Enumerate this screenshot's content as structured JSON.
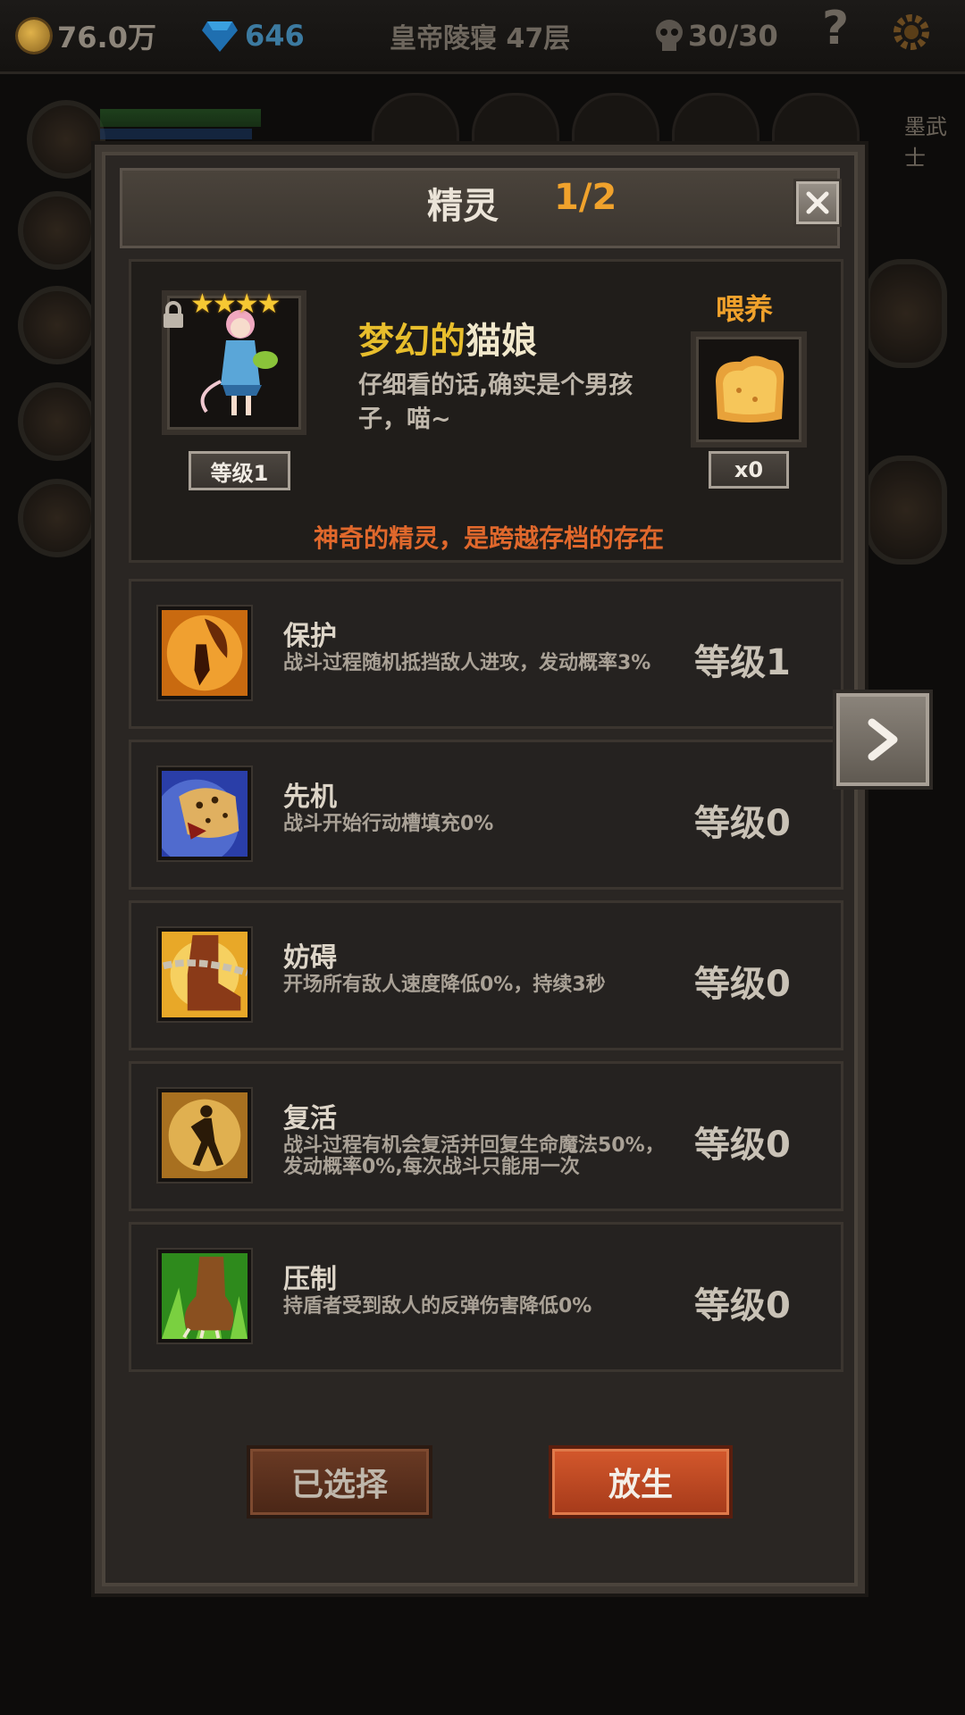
{
  "topbar": {
    "gold": "76.0万",
    "gems": "646",
    "location": "皇帝陵寝 47层",
    "stamina": "30/30",
    "help": "?"
  },
  "background": {
    "right_label": "墨武士"
  },
  "dialog": {
    "title": "精灵",
    "page": "1/2",
    "pet": {
      "stars": "★★★★",
      "level": "等级1",
      "name_prefix": "梦幻的",
      "name_main": "猫娘",
      "description": "仔细看的话,确实是个男孩子，喵~",
      "feed_label": "喂养",
      "food_count": "x0",
      "tagline": "神奇的精灵，是跨越存档的存在"
    },
    "skills": [
      {
        "name": "保护",
        "desc": "战斗过程随机抵挡敌人进攻，发动概率3%",
        "level": "等级1",
        "icon": "fairy-shield-icon"
      },
      {
        "name": "先机",
        "desc": "战斗开始行动槽填充0%",
        "level": "等级0",
        "icon": "leopard-icon"
      },
      {
        "name": "妨碍",
        "desc": "开场所有敌人速度降低0%，持续3秒",
        "level": "等级0",
        "icon": "chained-boot-icon"
      },
      {
        "name": "复活",
        "desc": "战斗过程有机会复活并回复生命魔法50%，发动概率0%,每次战斗只能用一次",
        "level": "等级0",
        "icon": "revive-silhouette-icon"
      },
      {
        "name": "压制",
        "desc": "持盾者受到敌人的反弹伤害降低0%",
        "level": "等级0",
        "icon": "beast-claw-icon"
      }
    ],
    "buttons": {
      "selected": "已选择",
      "release": "放生"
    }
  },
  "colors": {
    "accent_orange": "#f0a22c",
    "tagline": "#e0682c",
    "name_gold": "#e8be2c",
    "release_button": "#c24a22"
  }
}
